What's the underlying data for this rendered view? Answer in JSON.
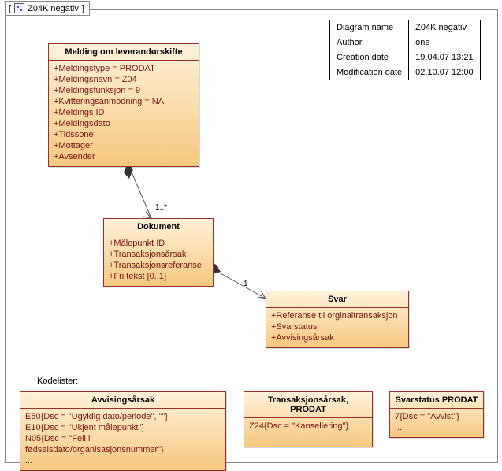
{
  "frame": {
    "title": "Z04K negativ"
  },
  "meta": {
    "rows": [
      {
        "k": "Diagram name",
        "v": "Z04K negativ"
      },
      {
        "k": "Author",
        "v": "one"
      },
      {
        "k": "Creation date",
        "v": "19.04.07 13:21"
      },
      {
        "k": "Modification date",
        "v": "02.10.07 12:00"
      }
    ]
  },
  "classes": {
    "melding": {
      "title": "Melding om leverandørskifte",
      "attrs": [
        "+Meldingstype = PRODAT",
        "+Meldingsnavn = Z04",
        "+Meldingsfunksjon = 9",
        "+Kvitteringsanmodning = NA",
        "+Meldings ID",
        "+Meldingsdato",
        "+Tidssone",
        "+Mottager",
        "+Avsender"
      ]
    },
    "dokument": {
      "title": "Dokument",
      "attrs": [
        "+Målepunkt ID",
        "+Transaksjonsårsak",
        "+Transaksjonsreferanse",
        "+Fri tekst [0..1]"
      ]
    },
    "svar": {
      "title": "Svar",
      "attrs": [
        "+Referanse til orginaltransaksjon",
        "+Svarstatus",
        "+Avvisingsårsak"
      ]
    },
    "avvisingsarsak": {
      "title": "Avvisingsårsak",
      "attrs": [
        "E50{Dsc = \"Ugyldig dato/periode\", \"\"}",
        "E10{Dsc = \"Ukjent målepunkt\"}",
        "N05{Dsc = \"Feil i fødselsdato/organisasjonsnummer\"}",
        "..."
      ]
    },
    "transaksjonsarsak": {
      "title": "Transaksjonsårsak, PRODAT",
      "attrs": [
        "Z24{Dsc = \"Kansellering\"}",
        "..."
      ]
    },
    "svarstatus": {
      "title": "Svarstatus PRODAT",
      "attrs": [
        "7{Dsc = \"Avvist\"}",
        "..."
      ]
    }
  },
  "labels": {
    "kodelister": "Kodelister:",
    "mult_dokument": "1..*",
    "mult_svar": "1"
  }
}
